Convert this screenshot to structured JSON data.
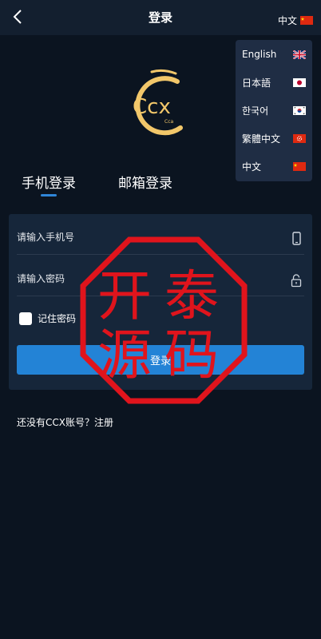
{
  "header": {
    "title": "登录",
    "current_language": "中文",
    "back_icon": "chevron-left-icon"
  },
  "language_menu": {
    "items": [
      {
        "label": "English",
        "flag": "uk-flag-icon"
      },
      {
        "label": "日本語",
        "flag": "japan-flag-icon"
      },
      {
        "label": "한국어",
        "flag": "korea-flag-icon"
      },
      {
        "label": "繁體中文",
        "flag": "hongkong-flag-icon"
      },
      {
        "label": "中文",
        "flag": "china-flag-icon"
      }
    ]
  },
  "logo": {
    "text": "Ccx",
    "subtext": "Cca",
    "color": "#f2c76a"
  },
  "tabs": [
    {
      "label": "手机登录",
      "active": true
    },
    {
      "label": "邮箱登录",
      "active": false
    }
  ],
  "form": {
    "phone_placeholder": "请输入手机号",
    "password_placeholder": "请输入密码",
    "remember_label": "记住密码",
    "login_button": "登录"
  },
  "register_text": "还没有CCX账号？注册",
  "watermark": {
    "chars": [
      "开",
      "泰",
      "源",
      "码"
    ],
    "color": "#e0141c"
  },
  "colors": {
    "background": "#0b1420",
    "accent": "#2383d6",
    "card": "#16263a"
  }
}
